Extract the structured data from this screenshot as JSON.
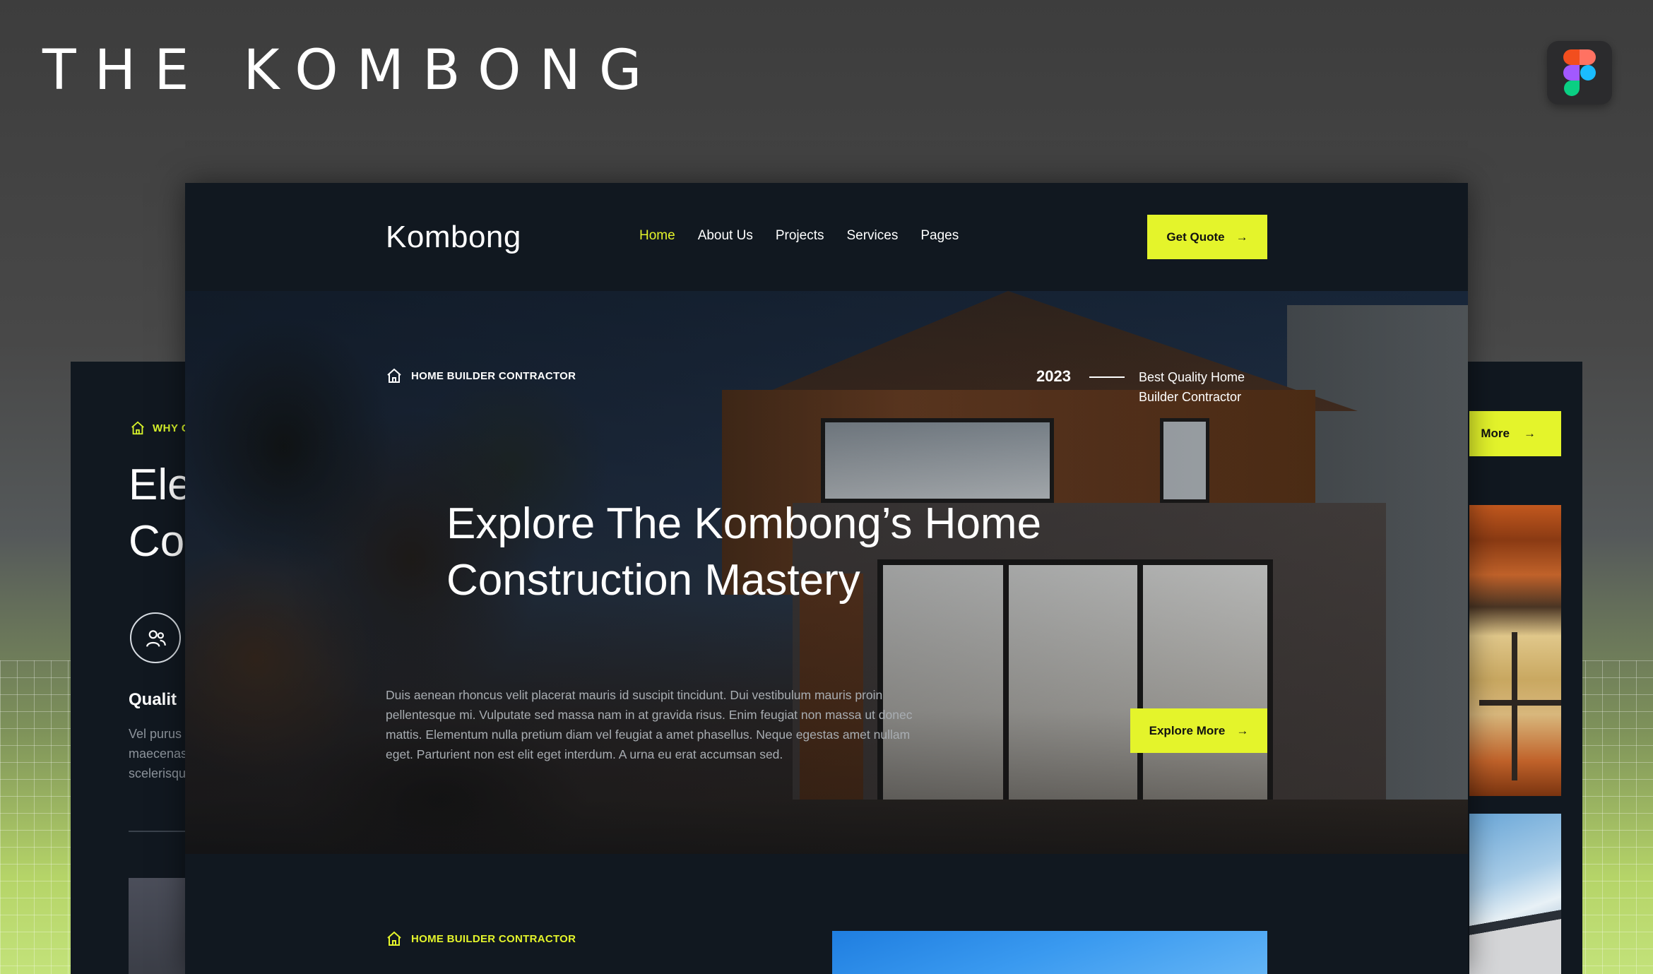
{
  "brand": {
    "title": "THE KOMBONG",
    "badge_icon": "figma-icon"
  },
  "colors": {
    "accent": "#e4f42b",
    "panel_bg": "#111820",
    "text_muted": "#a8adb2"
  },
  "back_left": {
    "tag": "WHY C",
    "heading_line1": "Ele",
    "heading_line2": "Co",
    "icon": "users-icon",
    "subheading": "Qualit",
    "text_line1": "Vel purus c",
    "text_line2": "maecenas",
    "text_line3": "scelerisqu"
  },
  "back_right": {
    "button_label": "More",
    "button_icon": "arrow-right-icon"
  },
  "nav": {
    "logo": "Kombong",
    "links": [
      {
        "label": "Home",
        "active": true
      },
      {
        "label": "About Us"
      },
      {
        "label": "Projects"
      },
      {
        "label": "Services"
      },
      {
        "label": "Pages"
      }
    ],
    "quote_label": "Get Quote",
    "quote_icon": "arrow-right-icon"
  },
  "hero": {
    "tag": "HOME BUILDER CONTRACTOR",
    "tag_icon": "home-icon",
    "year": "2023",
    "year_caption_line1": "Best Quality Home",
    "year_caption_line2": "Builder Contractor",
    "title_line1": "Explore The Kombong’s Home",
    "title_line2": "Construction Mastery",
    "body": "Duis aenean rhoncus velit placerat mauris id suscipit tincidunt. Dui vestibulum mauris proin pellentesque mi. Vulputate sed massa nam in at gravida risus. Enim feugiat non massa ut donec mattis. Elementum nulla pretium diam vel feugiat a amet phasellus. Neque egestas amet nullam eget. Parturient non est elit eget interdum. A urna eu erat accumsan sed.",
    "explore_label": "Explore More",
    "explore_icon": "arrow-right-icon"
  },
  "section2": {
    "tag": "HOME BUILDER CONTRACTOR",
    "tag_icon": "home-icon"
  }
}
